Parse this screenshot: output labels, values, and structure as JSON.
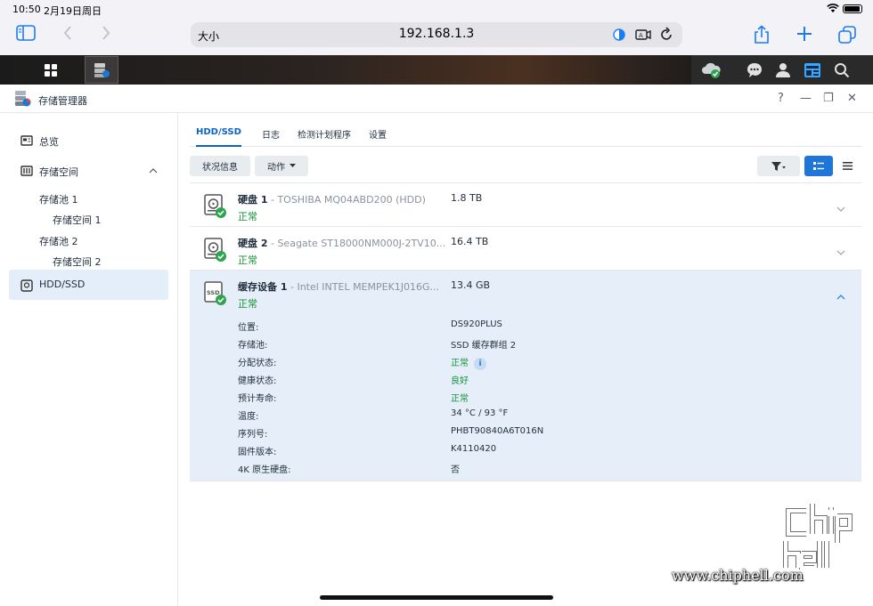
{
  "status_bar": {
    "time": "10:50",
    "date": "2月19日周日"
  },
  "safari": {
    "text_size_label": "大小",
    "url": "192.168.1.3"
  },
  "window": {
    "title": "存储管理器",
    "help": "?",
    "minimize": "—",
    "restore": "❐",
    "close": "✕"
  },
  "sidebar": {
    "items": [
      {
        "label": "总览"
      },
      {
        "label": "存储空间"
      },
      {
        "label": "HDD/SSD"
      }
    ],
    "subitems": [
      {
        "label": "存储池 1"
      },
      {
        "label": "存储空间 1"
      },
      {
        "label": "存储池 2"
      },
      {
        "label": "存储空间 2"
      }
    ]
  },
  "tabs": [
    {
      "label": "HDD/SSD"
    },
    {
      "label": "日志"
    },
    {
      "label": "检测计划程序"
    },
    {
      "label": "设置"
    }
  ],
  "toolbar": {
    "status_button": "状况信息",
    "action_button": "动作"
  },
  "disks": [
    {
      "name": "硬盘 1",
      "model": " - TOSHIBA MQ04ABD200 (HDD)",
      "status": "正常",
      "size": "1.8 TB"
    },
    {
      "name": "硬盘 2",
      "model": " - Seagate ST18000NM000J-2TV10...",
      "status": "正常",
      "size": "16.4 TB"
    },
    {
      "name": "缓存设备 1",
      "model": " - Intel INTEL MEMPEK1J016G...",
      "status": "正常",
      "size": "13.4 GB"
    }
  ],
  "details": [
    {
      "label": "位置:",
      "value": "DS920PLUS"
    },
    {
      "label": "存储池:",
      "value": "SSD 缓存群组 2"
    },
    {
      "label": "分配状态:",
      "value": "正常"
    },
    {
      "label": "健康状态:",
      "value": "良好"
    },
    {
      "label": "预计寿命:",
      "value": "正常"
    },
    {
      "label": "温度:",
      "value": "34 °C / 93 °F"
    },
    {
      "label": "序列号:",
      "value": "PHBT90840A6T016N"
    },
    {
      "label": "固件版本:",
      "value": "K4110420"
    },
    {
      "label": "4K 原生硬盘:",
      "value": "否"
    }
  ],
  "watermark": {
    "url": "www.chiphell.com"
  },
  "colors": {
    "accent": "#1e76d8",
    "ok_green": "#14923a",
    "selected_bg": "#e6eff9"
  }
}
